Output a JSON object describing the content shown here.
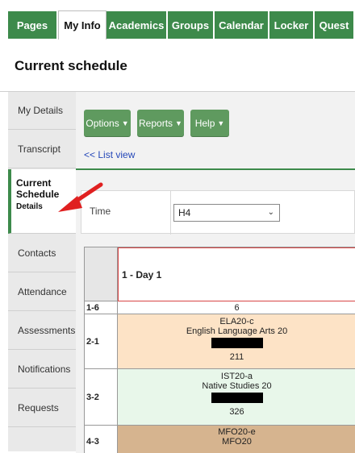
{
  "nav": {
    "tabs": [
      {
        "label": "Pages"
      },
      {
        "label": "My Info"
      },
      {
        "label": "Academics"
      },
      {
        "label": "Groups"
      },
      {
        "label": "Calendar"
      },
      {
        "label": "Locker"
      },
      {
        "label": "Quest"
      }
    ]
  },
  "page": {
    "title": "Current schedule"
  },
  "sidebar": {
    "items": [
      {
        "label": "My Details"
      },
      {
        "label": "Transcript"
      },
      {
        "label": "Current Schedule",
        "sub": "Details"
      },
      {
        "label": "Contacts"
      },
      {
        "label": "Attendance"
      },
      {
        "label": "Assessments"
      },
      {
        "label": "Notifications"
      },
      {
        "label": "Requests"
      }
    ]
  },
  "toolbar": {
    "options_label": "Options",
    "reports_label": "Reports",
    "help_label": "Help",
    "list_view_link": "<< List view"
  },
  "filter": {
    "label": "Time",
    "value": "H4"
  },
  "schedule": {
    "day_header": "1 - Day 1",
    "rows": [
      {
        "label": "1-6",
        "lines": [
          "6"
        ],
        "bg": "#ffffff"
      },
      {
        "label": "2-1",
        "lines": [
          "ELA20-c",
          "English Language Arts 20",
          "211"
        ],
        "bg": "#fde3c6"
      },
      {
        "label": "3-2",
        "lines": [
          "IST20-a",
          "Native Studies 20",
          "326"
        ],
        "bg": "#e8f7ea"
      },
      {
        "label": "4-3",
        "lines": [
          "MFO20-e",
          "MFO20"
        ],
        "bg": "#d6b48f"
      }
    ]
  },
  "colors": {
    "accent": "#3d8a4b",
    "button": "#5f9a5f",
    "annotation": "#e02020"
  }
}
